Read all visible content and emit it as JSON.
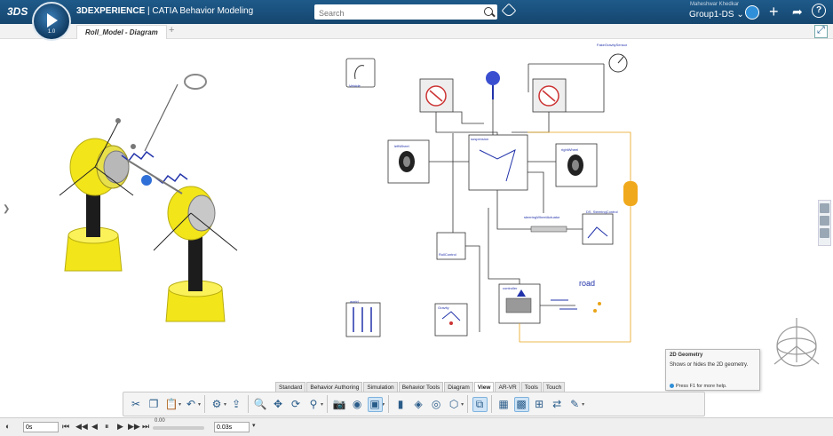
{
  "header": {
    "brand_logo": "3DS",
    "compass_version": "1.0",
    "app_title_bold": "3DEXPERIENCE",
    "app_title_rest": " | CATIA Behavior Modeling",
    "search_placeholder": "Search",
    "user_name": "Maheshwar Khedkar",
    "group": "Group1-DS",
    "avatar_initials": "MK"
  },
  "tabs_doc": {
    "active": "Roll_Model - Diagram",
    "add": "+"
  },
  "diagram": {
    "labels": {
      "vehicle": "Vehicle",
      "left_wheel": "leftWheel",
      "right_wheel": "rightWheel",
      "steering": "steeringWheelActuator",
      "road": "road",
      "world": "world",
      "gravity": "Gravity",
      "controller": "controller",
      "roll_control": "RollControl",
      "sensor": "FakeGravitySensor",
      "chassis": "suspension",
      "ws": "DS_SteeringControl"
    }
  },
  "tooltip": {
    "title": "2D Geometry",
    "body": "Shows or hides the 2D geometry.",
    "help": "Press F1 for more help."
  },
  "ribbon_tabs": [
    "Standard",
    "Behavior Authoring",
    "Simulation",
    "Behavior Tools",
    "Diagram",
    "View",
    "AR-VR",
    "Tools",
    "Touch"
  ],
  "ribbon_active": "View",
  "player": {
    "time": "0s",
    "slider_value": "0.00",
    "slider_fraction": 0.0,
    "step": "0.03s"
  },
  "colors": {
    "top_bar": "#1e5a8a",
    "vehicle_yellow": "#f2e51a",
    "diagram_blue": "#2233aa",
    "ribbon_highlight": "#cfe4f6"
  }
}
